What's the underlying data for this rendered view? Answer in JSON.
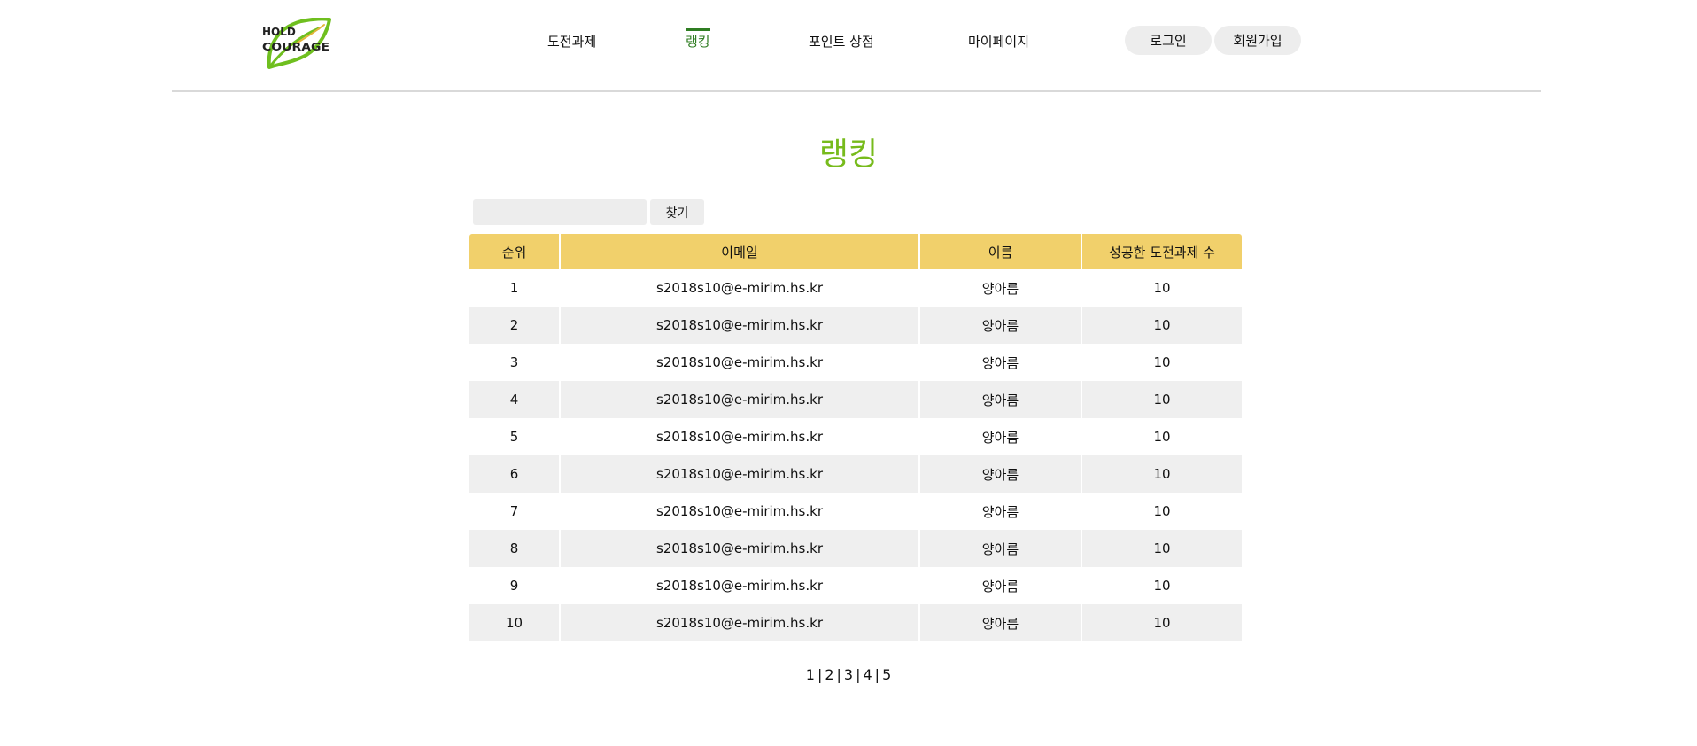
{
  "header": {
    "logo_text_line1": "HOLD",
    "logo_text_line2": "COURAGE",
    "nav": [
      {
        "label": "도전과제",
        "active": false
      },
      {
        "label": "랭킹",
        "active": true
      },
      {
        "label": "포인트 상점",
        "active": false
      },
      {
        "label": "마이페이지",
        "active": false
      }
    ],
    "login_label": "로그인",
    "signup_label": "회원가입"
  },
  "page": {
    "title": "랭킹"
  },
  "search": {
    "value": "",
    "placeholder": "",
    "button_label": "찾기"
  },
  "table": {
    "columns": [
      "순위",
      "이메일",
      "이름",
      "성공한 도전과제 수"
    ],
    "rows": [
      [
        "1",
        "s2018s10@e-mirim.hs.kr",
        "양아름",
        "10"
      ],
      [
        "2",
        "s2018s10@e-mirim.hs.kr",
        "양아름",
        "10"
      ],
      [
        "3",
        "s2018s10@e-mirim.hs.kr",
        "양아름",
        "10"
      ],
      [
        "4",
        "s2018s10@e-mirim.hs.kr",
        "양아름",
        "10"
      ],
      [
        "5",
        "s2018s10@e-mirim.hs.kr",
        "양아름",
        "10"
      ],
      [
        "6",
        "s2018s10@e-mirim.hs.kr",
        "양아름",
        "10"
      ],
      [
        "7",
        "s2018s10@e-mirim.hs.kr",
        "양아름",
        "10"
      ],
      [
        "8",
        "s2018s10@e-mirim.hs.kr",
        "양아름",
        "10"
      ],
      [
        "9",
        "s2018s10@e-mirim.hs.kr",
        "양아름",
        "10"
      ],
      [
        "10",
        "s2018s10@e-mirim.hs.kr",
        "양아름",
        "10"
      ]
    ]
  },
  "pagination": {
    "pages": [
      "1",
      "2",
      "3",
      "4",
      "5"
    ],
    "separator": "|"
  },
  "colors": {
    "accent_green": "#77bb1c",
    "nav_active": "#2f7d22",
    "table_header": "#f1d06b",
    "row_stripe": "#efefef",
    "button_gray": "#ededed"
  }
}
